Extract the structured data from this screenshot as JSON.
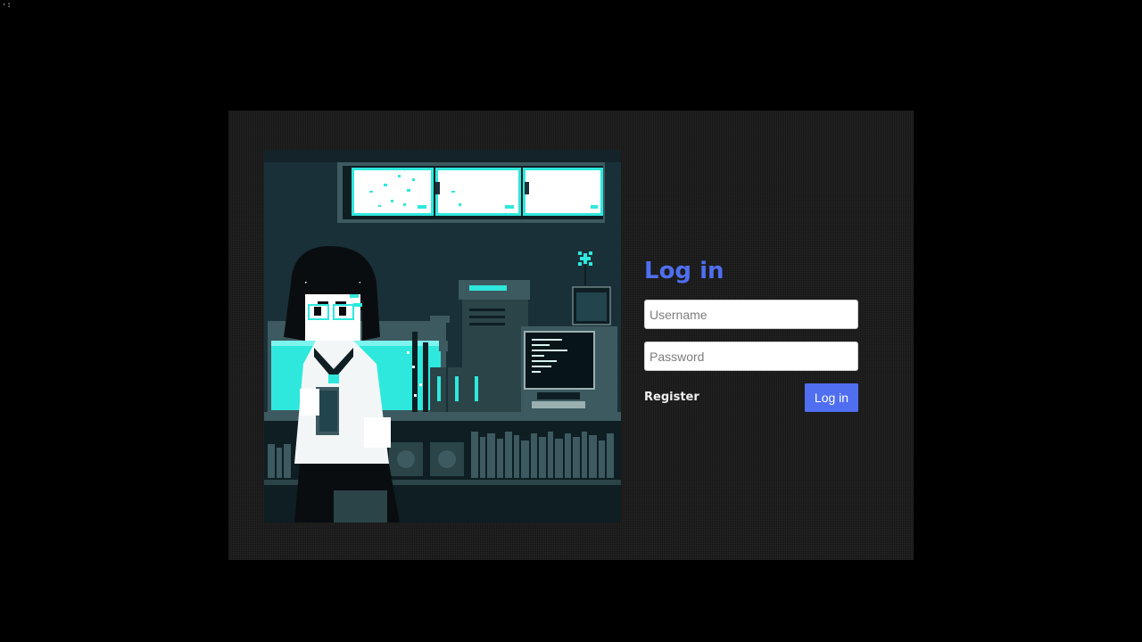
{
  "colors": {
    "page_background": "#000000",
    "card_background": "#1e1e1e",
    "accent": "#4f6ef0",
    "art_teal": "#2ee8dd",
    "art_dark": "#172c33"
  },
  "illustration": {
    "subject": "pixel-art girl with glasses and sailor uniform holding a book in a room with aquarium, computers and bookshelf",
    "icon": "pixel-art-illustration"
  },
  "login": {
    "title": "Log in",
    "username_placeholder": "Username",
    "username_value": "",
    "password_placeholder": "Password",
    "password_value": "",
    "register_label": "Register",
    "submit_label": "Log in"
  }
}
